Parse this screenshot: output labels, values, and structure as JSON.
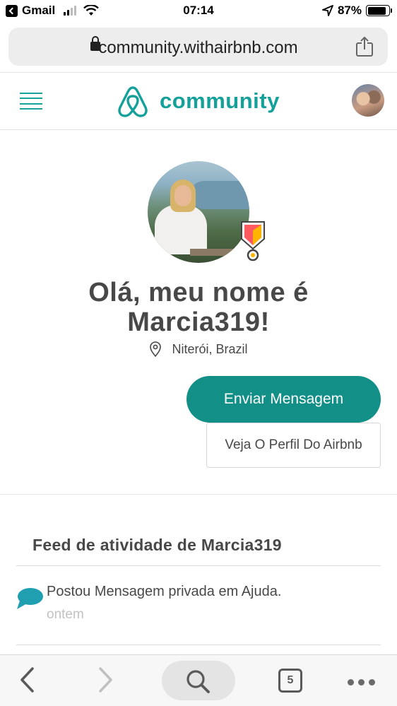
{
  "status_bar": {
    "back_app": "Gmail",
    "time": "07:14",
    "battery": "87%",
    "battery_level": 0.87
  },
  "browser": {
    "url": "community.withairbnb.com",
    "open_tabs": "5"
  },
  "header": {
    "logo_text": "community",
    "brand_color": "#15a19a"
  },
  "profile": {
    "title": "Olá, meu nome é Marcia319!",
    "location": "Niterói, Brazil",
    "send_message_label": "Enviar Mensagem",
    "view_profile_label": "Veja O Perfil Do Airbnb",
    "button_color": "#128f87"
  },
  "feed": {
    "title": "Feed de atividade de Marcia319",
    "items": [
      {
        "text": "Postou Mensagem privada em Ajuda.",
        "time": "ontem",
        "icon": "chat-bubble-icon"
      }
    ]
  }
}
